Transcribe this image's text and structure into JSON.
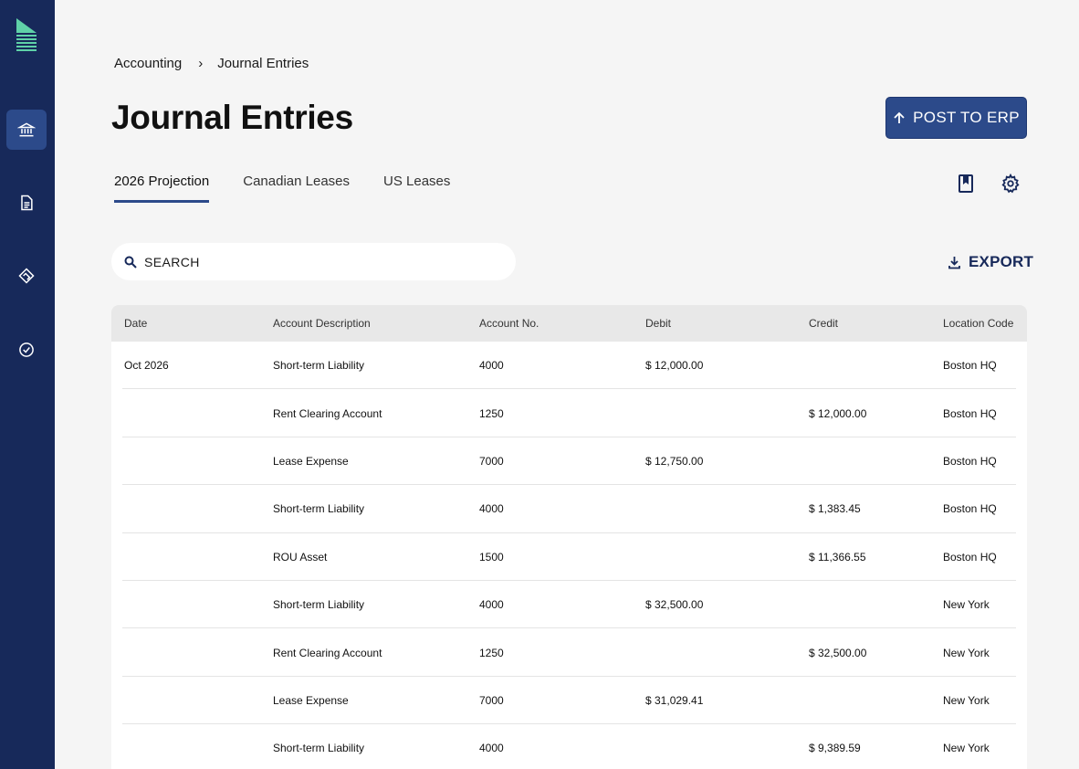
{
  "breadcrumb": {
    "parent": "Accounting",
    "separator": "›",
    "current": "Journal Entries"
  },
  "page_title": "Journal Entries",
  "post_button": {
    "label": "POST TO ERP"
  },
  "tabs": [
    {
      "label": "2026 Projection",
      "active": true
    },
    {
      "label": "Canadian Leases",
      "active": false
    },
    {
      "label": "US Leases",
      "active": false
    }
  ],
  "search": {
    "placeholder": "SEARCH",
    "value": ""
  },
  "export_label": "EXPORT",
  "icons": {
    "sidebar": [
      "bank-icon",
      "document-icon",
      "handshake-icon",
      "check-circle-icon"
    ],
    "toolbar": [
      "book-icon",
      "gear-icon"
    ]
  },
  "colors": {
    "sidebar": "#17295a",
    "accent": "#2c4a8a",
    "logo": "#5fd1a8"
  },
  "table": {
    "headers": [
      "Date",
      "Account Description",
      "Account No.",
      "Debit",
      "Credit",
      "Location Code"
    ],
    "rows": [
      {
        "date": "Oct 2026",
        "desc": "Short-term Liability",
        "acct": "4000",
        "debit": "$ 12,000.00",
        "credit": "",
        "loc": "Boston HQ"
      },
      {
        "date": "",
        "desc": "Rent Clearing Account",
        "acct": "1250",
        "debit": "",
        "credit": "$ 12,000.00",
        "loc": "Boston HQ"
      },
      {
        "date": "",
        "desc": "Lease Expense",
        "acct": "7000",
        "debit": "$ 12,750.00",
        "credit": "",
        "loc": "Boston HQ"
      },
      {
        "date": "",
        "desc": "Short-term Liability",
        "acct": "4000",
        "debit": "",
        "credit": "$ 1,383.45",
        "loc": "Boston HQ"
      },
      {
        "date": "",
        "desc": "ROU Asset",
        "acct": "1500",
        "debit": "",
        "credit": "$ 11,366.55",
        "loc": "Boston HQ"
      },
      {
        "date": "",
        "desc": "Short-term Liability",
        "acct": "4000",
        "debit": "$ 32,500.00",
        "credit": "",
        "loc": "New York"
      },
      {
        "date": "",
        "desc": "Rent Clearing Account",
        "acct": "1250",
        "debit": "",
        "credit": "$ 32,500.00",
        "loc": "New York"
      },
      {
        "date": "",
        "desc": "Lease Expense",
        "acct": "7000",
        "debit": "$ 31,029.41",
        "credit": "",
        "loc": "New York"
      },
      {
        "date": "",
        "desc": "Short-term Liability",
        "acct": "4000",
        "debit": "",
        "credit": "$ 9,389.59",
        "loc": "New York"
      }
    ]
  }
}
